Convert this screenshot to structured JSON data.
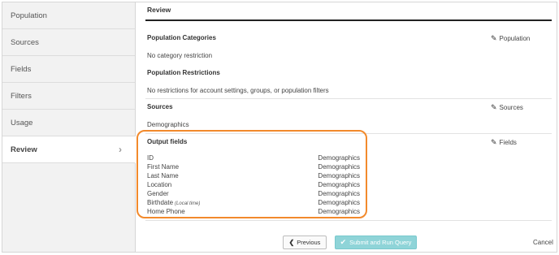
{
  "sidebar": {
    "items": [
      {
        "label": "Population"
      },
      {
        "label": "Sources"
      },
      {
        "label": "Fields"
      },
      {
        "label": "Filters"
      },
      {
        "label": "Usage"
      },
      {
        "label": "Review",
        "active": true
      }
    ],
    "active_chevron_icon": "chevron-right-icon"
  },
  "main": {
    "title": "Review",
    "population_categories": {
      "heading": "Population Categories",
      "text": "No category restriction",
      "edit_label": "Population"
    },
    "population_restrictions": {
      "heading": "Population Restrictions",
      "text": "No restrictions for account settings, groups, or population filters"
    },
    "sources": {
      "heading": "Sources",
      "text": "Demographics",
      "edit_label": "Sources"
    },
    "output_fields": {
      "heading": "Output fields",
      "edit_label": "Fields",
      "rows": [
        {
          "name": "ID",
          "note": "",
          "source": "Demographics"
        },
        {
          "name": "First Name",
          "note": "",
          "source": "Demographics"
        },
        {
          "name": "Last Name",
          "note": "",
          "source": "Demographics"
        },
        {
          "name": "Location",
          "note": "",
          "source": "Demographics"
        },
        {
          "name": "Gender",
          "note": "",
          "source": "Demographics"
        },
        {
          "name": "Birthdate",
          "note": "(Local time)",
          "source": "Demographics"
        },
        {
          "name": "Home Phone",
          "note": "",
          "source": "Demographics"
        }
      ]
    },
    "edit_icon": "pencil-icon"
  },
  "footer": {
    "previous_label": "Previous",
    "previous_icon": "chevron-left-icon",
    "submit_label": "Submit and Run Query",
    "submit_icon": "checkmark-icon",
    "cancel_label": "Cancel"
  },
  "colors": {
    "highlight": "#f28a2c",
    "submit_bg": "#8fd4d8"
  }
}
